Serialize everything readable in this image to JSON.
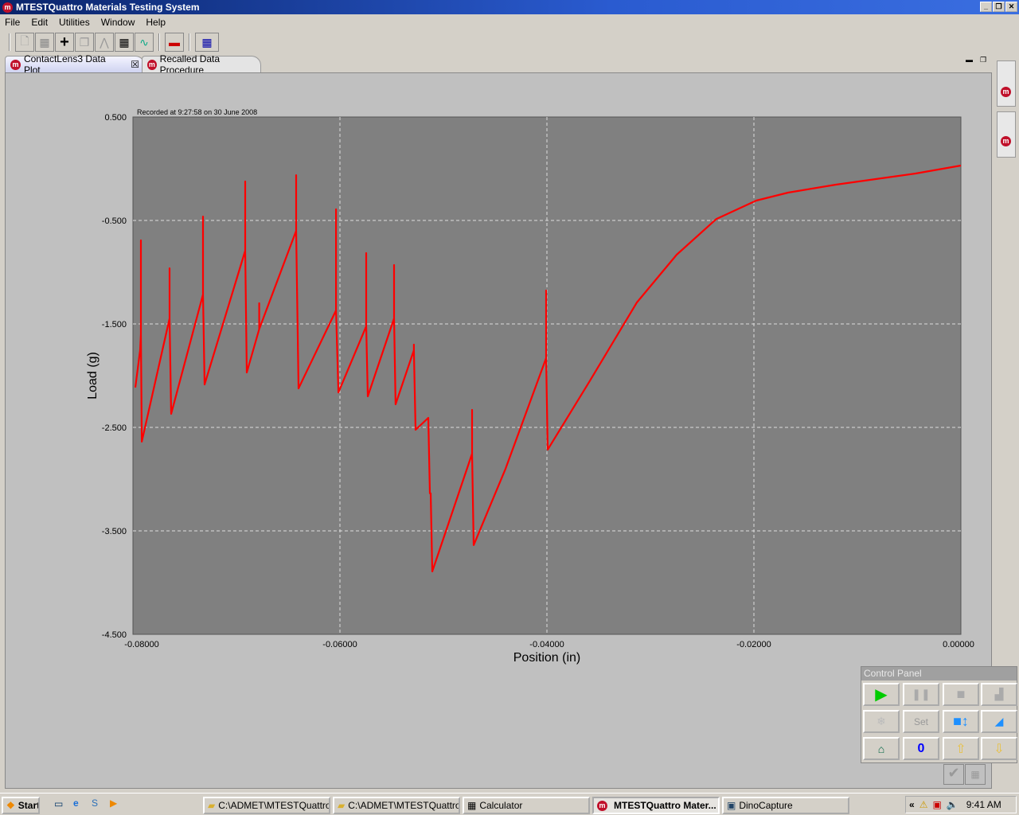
{
  "window": {
    "title": "MTESTQuattro Materials Testing System",
    "logo": "mt"
  },
  "menu": [
    "File",
    "Edit",
    "Utilities",
    "Window",
    "Help"
  ],
  "toolbar_icons": [
    "new-document-icon",
    "save-icon",
    "add-icon",
    "copy-icon",
    "peak-icon",
    "table-icon",
    "waveform-icon",
    "display-icon",
    "layout-icon"
  ],
  "tabs": [
    {
      "label": "ContactLens3 Data Plot",
      "active": true
    },
    {
      "label": "Recalled Data Procedure",
      "active": false
    }
  ],
  "chart_data": {
    "type": "line",
    "annotation": "Recorded at 9:27:58 on 30 June 2008",
    "xlabel": "Position (in)",
    "ylabel": "Load (g)",
    "xlim": [
      -0.08,
      0
    ],
    "ylim": [
      -4.5,
      0.5
    ],
    "xticks": [
      "-0.08000",
      "-0.06000",
      "-0.04000",
      "-0.02000",
      "0.00000"
    ],
    "yticks": [
      "0.500",
      "-0.500",
      "-1.500",
      "-2.500",
      "-3.500",
      "-4.500"
    ],
    "grid": true,
    "background": "#808080",
    "series": [
      {
        "name": "Load",
        "color": "#ff0000",
        "points": [
          [
            -0.07977,
            -2.115
          ],
          [
            -0.07931,
            -1.754
          ],
          [
            -0.07923,
            -1.6
          ],
          [
            -0.07923,
            -0.692
          ],
          [
            -0.07923,
            -1.6
          ],
          [
            -0.07915,
            -2.638
          ],
          [
            -0.07646,
            -1.446
          ],
          [
            -0.07646,
            -0.962
          ],
          [
            -0.07646,
            -1.446
          ],
          [
            -0.07631,
            -2.369
          ],
          [
            -0.07323,
            -1.215
          ],
          [
            -0.07323,
            -0.462
          ],
          [
            -0.07323,
            -1.215
          ],
          [
            -0.07308,
            -2.085
          ],
          [
            -0.06915,
            -0.792
          ],
          [
            -0.06915,
            -0.123
          ],
          [
            -0.06915,
            -0.792
          ],
          [
            -0.069,
            -1.969
          ],
          [
            -0.0678,
            -1.55
          ],
          [
            -0.0678,
            -1.3
          ],
          [
            -0.0678,
            -1.55
          ],
          [
            -0.06423,
            -0.6
          ],
          [
            -0.06423,
            -0.062
          ],
          [
            -0.06423,
            -0.6
          ],
          [
            -0.064,
            -2.123
          ],
          [
            -0.06038,
            -1.369
          ],
          [
            -0.06038,
            -0.392
          ],
          [
            -0.06038,
            -1.369
          ],
          [
            -0.06015,
            -2.162
          ],
          [
            -0.05746,
            -1.523
          ],
          [
            -0.05746,
            -0.815
          ],
          [
            -0.05746,
            -1.523
          ],
          [
            -0.05731,
            -2.2
          ],
          [
            -0.05477,
            -1.446
          ],
          [
            -0.05477,
            -0.931
          ],
          [
            -0.05477,
            -1.446
          ],
          [
            -0.05462,
            -2.277
          ],
          [
            -0.05285,
            -1.754
          ],
          [
            -0.05285,
            -1.7
          ],
          [
            -0.05285,
            -1.754
          ],
          [
            -0.05269,
            -2.523
          ],
          [
            -0.05146,
            -2.408
          ],
          [
            -0.05131,
            -3.138
          ],
          [
            -0.05123,
            -3.138
          ],
          [
            -0.05108,
            -3.892
          ],
          [
            -0.04723,
            -2.754
          ],
          [
            -0.04723,
            -2.331
          ],
          [
            -0.04723,
            -2.754
          ],
          [
            -0.04708,
            -3.638
          ],
          [
            -0.044,
            -2.9
          ],
          [
            -0.04008,
            -1.831
          ],
          [
            -0.04008,
            -1.177
          ],
          [
            -0.04008,
            -1.831
          ],
          [
            -0.03992,
            -2.715
          ],
          [
            -0.03592,
            -2.062
          ],
          [
            -0.03131,
            -1.292
          ],
          [
            -0.02746,
            -0.831
          ],
          [
            -0.02362,
            -0.485
          ],
          [
            -0.01977,
            -0.308
          ],
          [
            -0.01669,
            -0.231
          ],
          [
            -0.01208,
            -0.154
          ],
          [
            -0.00823,
            -0.1
          ],
          [
            -0.00438,
            -0.046
          ],
          [
            0,
            0.031
          ]
        ]
      }
    ]
  },
  "control_panel": {
    "title": "Control Panel",
    "set_label": "Set",
    "zero_label": "0"
  },
  "taskbar": {
    "start": "Start",
    "tasks": [
      "C:\\ADMET\\MTESTQuattro",
      "C:\\ADMET\\MTESTQuattro",
      "Calculator",
      "MTESTQuattro Mater...",
      "DinoCapture"
    ],
    "clock": "9:41 AM",
    "tray_arrows": "«"
  }
}
